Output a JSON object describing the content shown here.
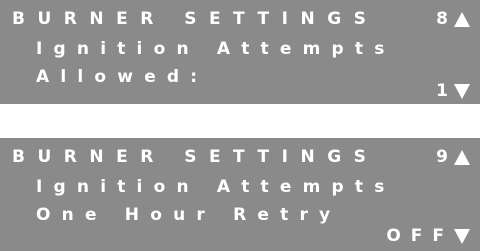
{
  "colors": {
    "screen_bg": "#8a8a8a",
    "text": "#ffffff"
  },
  "screens": [
    {
      "title": "BURNER SETTINGS",
      "page_number": "8",
      "line2": "Ignition Attempts",
      "line3": "Allowed:",
      "value": "1",
      "up_icon": "arrow-up-triangle-icon",
      "down_icon": "arrow-down-triangle-icon"
    },
    {
      "title": "BURNER SETTINGS",
      "page_number": "9",
      "line2": "Ignition Attempts",
      "line3": "One Hour Retry",
      "value": "OFF",
      "up_icon": "arrow-up-triangle-icon",
      "down_icon": "arrow-down-triangle-icon"
    }
  ]
}
